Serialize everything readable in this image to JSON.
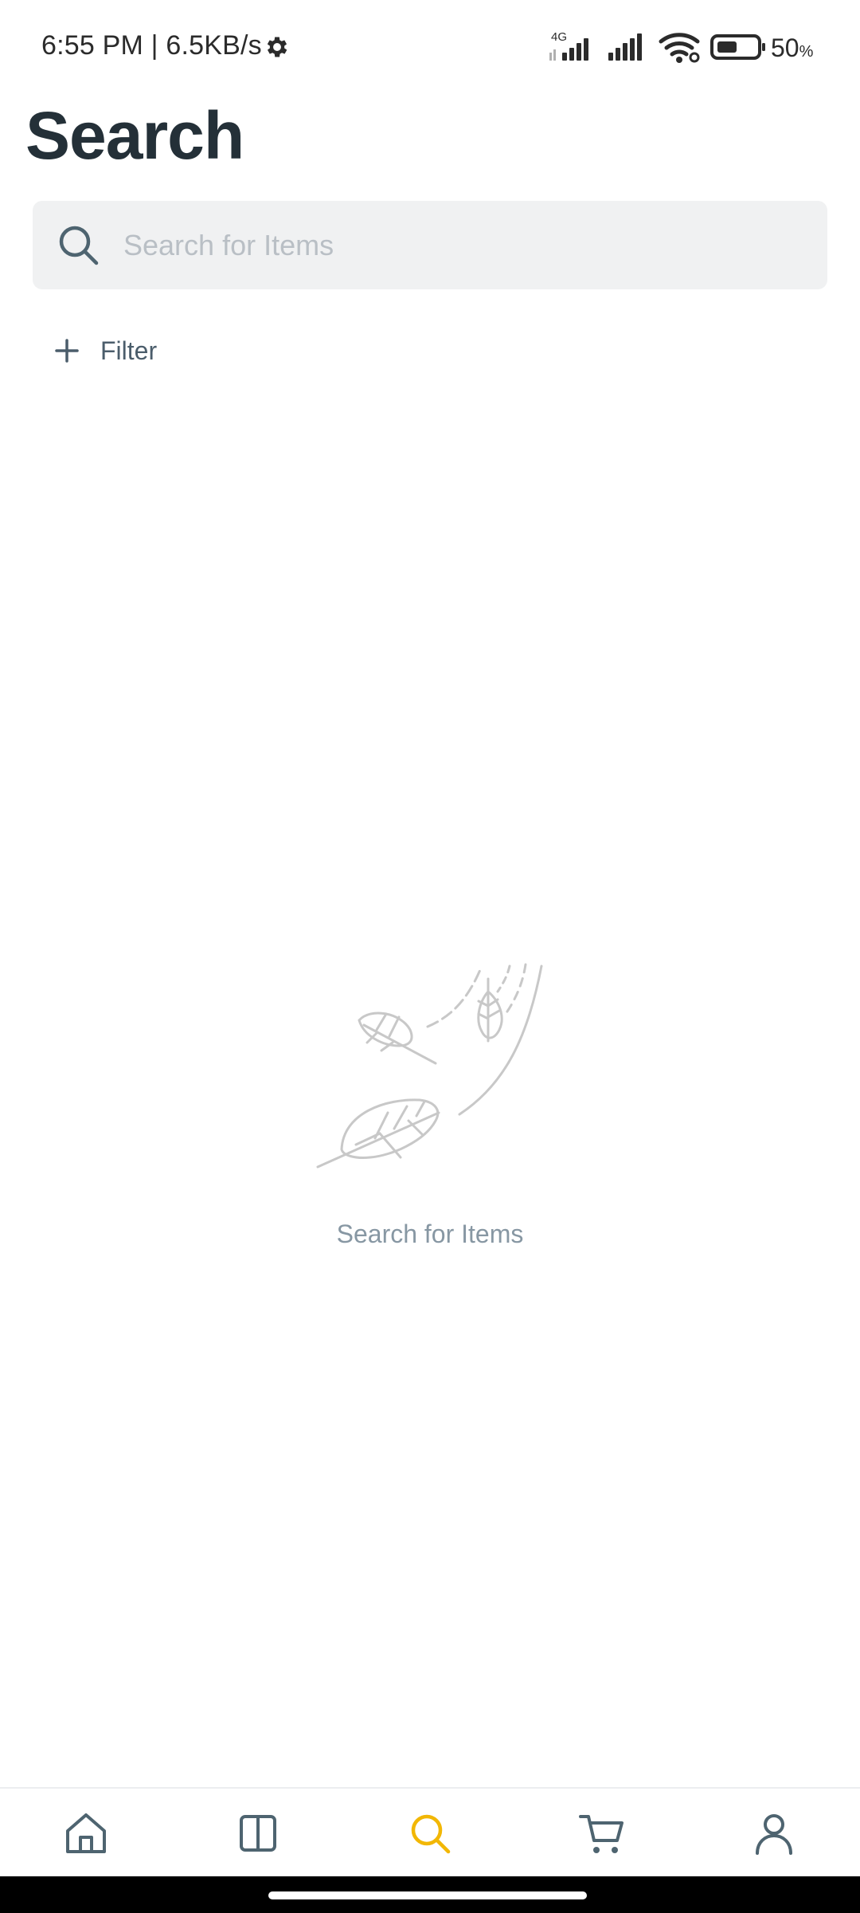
{
  "status_bar": {
    "time": "6:55 PM | 6.5KB/s",
    "network": "4G",
    "battery_percent": "50",
    "battery_unit": "%"
  },
  "header": {
    "title": "Search"
  },
  "search": {
    "placeholder": "Search for Items",
    "value": ""
  },
  "filter": {
    "label": "Filter"
  },
  "empty_state": {
    "message": "Search for Items",
    "illustration": "falling-leaves-icon"
  },
  "bottom_nav": {
    "items": [
      {
        "icon": "home-icon",
        "active": false
      },
      {
        "icon": "catalog-icon",
        "active": false
      },
      {
        "icon": "search-icon",
        "active": true
      },
      {
        "icon": "cart-icon",
        "active": false
      },
      {
        "icon": "profile-icon",
        "active": false
      }
    ]
  },
  "colors": {
    "accent": "#f2b705",
    "nav_inactive": "#4e6470",
    "title": "#243038"
  }
}
